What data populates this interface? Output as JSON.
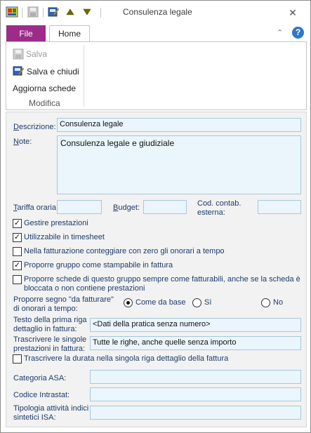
{
  "window": {
    "title": "Consulenza legale",
    "close_glyph": "✕"
  },
  "quick_access": [
    "app-icon",
    "save-icon",
    "edit-icon",
    "up-arrow-icon",
    "down-arrow-icon"
  ],
  "ribbon": {
    "tabs": {
      "file": "File",
      "home": "Home"
    },
    "save_label": "Salva",
    "save_close_label": "Salva e chiudi",
    "refresh_label": "Aggiorna schede",
    "group_label": "Modifica",
    "help": "?"
  },
  "form": {
    "descrizione": {
      "label": "Descrizione:",
      "value": "Consulenza legale"
    },
    "note": {
      "label": "Note:",
      "value": "Consulenza legale e giudiziale"
    },
    "tariffa": {
      "label": "Tariffa oraria",
      "value": ""
    },
    "budget": {
      "label": "Budget:",
      "value": ""
    },
    "cod_contab": {
      "label": "Cod. contab. esterna:",
      "value": ""
    },
    "checkboxes": {
      "gestire": {
        "label": "Gestire prestazioni",
        "checked": true
      },
      "utilizzabile": {
        "label": "Utilizzabile in timesheet",
        "checked": true
      },
      "zero": {
        "label": "Nella fatturazione conteggiare con zero gli onorari a tempo",
        "checked": false
      },
      "stampabile": {
        "label": "Proporre gruppo come stampabile in fattura",
        "checked": true
      },
      "fatturabili": {
        "label": "Proporre schede di questo gruppo sempre come fatturabili, anche se la scheda è bloccata o non contiene prestazioni",
        "checked": false
      },
      "durata": {
        "label": "Trascrivere la durata nella singola riga dettaglio della fattura",
        "checked": false
      }
    },
    "segno": {
      "label": "Proporre segno \"da fatturare\" di onorari a tempo:",
      "options": [
        "Come da base",
        "Sì",
        "No"
      ],
      "selected": "Come da base"
    },
    "prima_riga": {
      "label": "Testo della prima riga dettaglio in fattura:",
      "value": "<Dati della pratica senza numero>"
    },
    "singole": {
      "label": "Trascrivere le singole prestazioni in fattura:",
      "value": "Tutte le righe, anche quelle senza importo"
    },
    "categoria_asa": {
      "label": "Categoria ASA:",
      "value": ""
    },
    "intrastat": {
      "label": "Codice Intrastat:",
      "value": ""
    },
    "tipologia": {
      "label": "Tipologia attività indici sintetici ISA:",
      "value": ""
    }
  },
  "colors": {
    "accent_file_tab": "#9c2c88",
    "input_bg": "#eaf5fc",
    "label_text": "#1e3b6b"
  }
}
